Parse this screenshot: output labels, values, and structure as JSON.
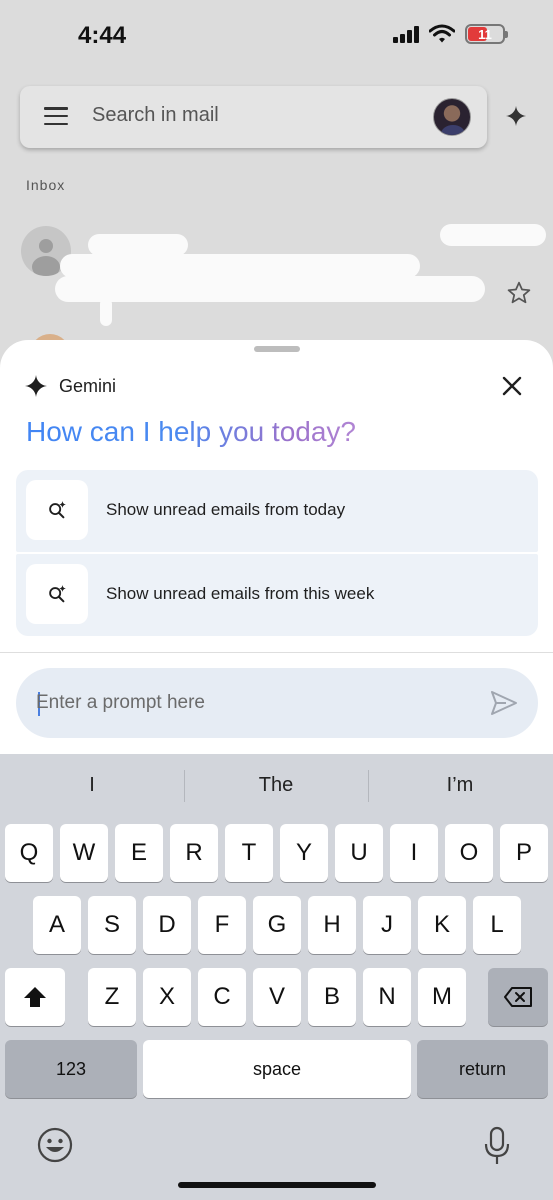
{
  "status_bar": {
    "time": "4:44",
    "battery": "11",
    "battery_color": "#e23b3b"
  },
  "search": {
    "placeholder": "Search in mail"
  },
  "inbox": {
    "label": "Inbox"
  },
  "gemini": {
    "name": "Gemini",
    "headline": "How can I help you today?",
    "suggestions": [
      {
        "label": "Show unread emails from today",
        "icon": "search-sparkle-icon"
      },
      {
        "label": "Show unread emails from this week",
        "icon": "search-sparkle-icon"
      }
    ],
    "prompt_placeholder": "Enter a prompt here"
  },
  "keyboard": {
    "suggestions": [
      "I",
      "The",
      "I’m"
    ],
    "row1": [
      "Q",
      "W",
      "E",
      "R",
      "T",
      "Y",
      "U",
      "I",
      "O",
      "P"
    ],
    "row2": [
      "A",
      "S",
      "D",
      "F",
      "G",
      "H",
      "J",
      "K",
      "L"
    ],
    "row3": [
      "Z",
      "X",
      "C",
      "V",
      "B",
      "N",
      "M"
    ],
    "numbers_label": "123",
    "space_label": "space",
    "return_label": "return"
  },
  "colors": {
    "accent_blue": "#4285f4",
    "accent_purple": "#9b72cb"
  }
}
